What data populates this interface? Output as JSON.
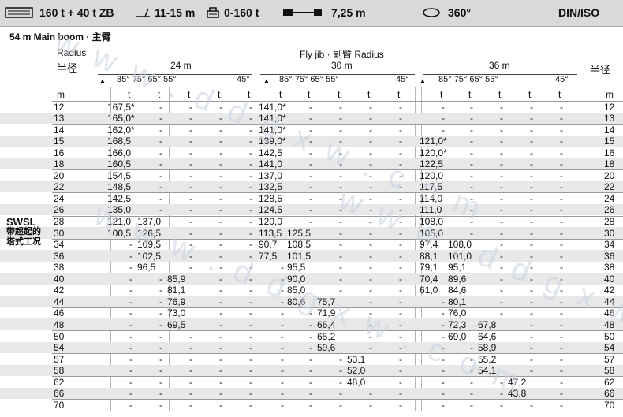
{
  "header": {
    "capacity": "160 t + 40 t ZB",
    "jib_angle": "11-15 m",
    "counterweight": "0-160 t",
    "track_width": "7,25 m",
    "slewing": "360°",
    "standard": "DIN/ISO"
  },
  "boom_label": "54 m  Main boom · 主臂",
  "radius_label": "Radius",
  "radius_label_cn": "半径",
  "fly_jib_label": "Fly jib · 副臂 Radius",
  "radius_right_cn": "半径",
  "jib_lengths": [
    "24 m",
    "30 m",
    "36 m"
  ],
  "angle_groups": [
    {
      "main": "85° 75° 65° 55°",
      "end": "45°"
    },
    {
      "main": "85° 75° 65° 55°",
      "end": "45°"
    },
    {
      "main": "85° 75° 65° 55°",
      "end": "45°"
    }
  ],
  "units": {
    "left": "m",
    "right": "m",
    "t": [
      "t",
      "t",
      "t",
      "t",
      "t",
      "t",
      "t",
      "t",
      "t",
      "t",
      "t",
      "t",
      "t",
      "t",
      "t"
    ]
  },
  "side_label": {
    "en": "SWSL",
    "cn1": "带超起的",
    "cn2": "塔式工况"
  },
  "rows": [
    {
      "r": "12",
      "v": [
        "167,5*",
        "-",
        "-",
        "-",
        "-",
        "141,0*",
        "-",
        "-",
        "-",
        "-",
        "-",
        "-",
        "-",
        "-",
        "-"
      ]
    },
    {
      "r": "13",
      "v": [
        "165,0*",
        "-",
        "-",
        "-",
        "-",
        "141,0*",
        "-",
        "-",
        "-",
        "-",
        "-",
        "-",
        "-",
        "-",
        "-"
      ]
    },
    {
      "r": "14",
      "v": [
        "162,0*",
        "-",
        "-",
        "-",
        "-",
        "141,0*",
        "-",
        "-",
        "-",
        "-",
        "-",
        "-",
        "-",
        "-",
        "-"
      ]
    },
    {
      "r": "15",
      "v": [
        "168,5",
        "-",
        "-",
        "-",
        "-",
        "139,0*",
        "-",
        "-",
        "-",
        "-",
        "121,0*",
        "-",
        "-",
        "-",
        "-"
      ]
    },
    {
      "r": "16",
      "v": [
        "166,0",
        "-",
        "-",
        "-",
        "-",
        "142,5",
        "-",
        "-",
        "-",
        "-",
        "120,0*",
        "-",
        "-",
        "-",
        "-"
      ]
    },
    {
      "r": "18",
      "v": [
        "160,5",
        "-",
        "-",
        "-",
        "-",
        "141,0",
        "-",
        "-",
        "-",
        "-",
        "122,5",
        "-",
        "-",
        "-",
        "-"
      ]
    },
    {
      "r": "20",
      "v": [
        "154,5",
        "-",
        "-",
        "-",
        "-",
        "137,0",
        "-",
        "-",
        "-",
        "-",
        "120,0",
        "-",
        "-",
        "-",
        "-"
      ]
    },
    {
      "r": "22",
      "v": [
        "148,5",
        "-",
        "-",
        "-",
        "-",
        "132,5",
        "-",
        "-",
        "-",
        "-",
        "117,5",
        "-",
        "-",
        "-",
        "-"
      ]
    },
    {
      "r": "24",
      "v": [
        "142,5",
        "-",
        "-",
        "-",
        "-",
        "128,5",
        "-",
        "-",
        "-",
        "-",
        "114,0",
        "-",
        "-",
        "-",
        "-"
      ]
    },
    {
      "r": "26",
      "v": [
        "135,0",
        "-",
        "-",
        "-",
        "-",
        "124,5",
        "-",
        "-",
        "-",
        "-",
        "111,0",
        "-",
        "-",
        "-",
        "-"
      ]
    },
    {
      "r": "28",
      "v": [
        "121,0",
        "137,0",
        "-",
        "-",
        "-",
        "120,0",
        "-",
        "-",
        "-",
        "-",
        "108,0",
        "-",
        "-",
        "-",
        "-"
      ]
    },
    {
      "r": "30",
      "v": [
        "100,5",
        "126,5",
        "-",
        "-",
        "-",
        "113,5",
        "125,5",
        "-",
        "-",
        "-",
        "105,0",
        "-",
        "-",
        "-",
        "-"
      ]
    },
    {
      "r": "34",
      "v": [
        "-",
        "109,5",
        "-",
        "-",
        "-",
        "90,7",
        "108,5",
        "-",
        "-",
        "-",
        "97,4",
        "108,0",
        "-",
        "-",
        "-"
      ]
    },
    {
      "r": "36",
      "v": [
        "-",
        "102,5",
        "-",
        "-",
        "-",
        "77,5",
        "101,5",
        "-",
        "-",
        "-",
        "88,1",
        "101,0",
        "-",
        "-",
        "-"
      ]
    },
    {
      "r": "38",
      "v": [
        "-",
        "96,5",
        "-",
        "-",
        "-",
        "-",
        "95,5",
        "-",
        "-",
        "-",
        "79,1",
        "95,1",
        "-",
        "-",
        "-"
      ]
    },
    {
      "r": "40",
      "v": [
        "-",
        "-",
        "85,9",
        "-",
        "-",
        "-",
        "90,0",
        "-",
        "-",
        "-",
        "70,4",
        "89,6",
        "-",
        "-",
        "-"
      ]
    },
    {
      "r": "42",
      "v": [
        "-",
        "-",
        "81,1",
        "-",
        "-",
        "-",
        "85,0",
        "-",
        "-",
        "-",
        "61,0",
        "84,6",
        "-",
        "-",
        "-"
      ]
    },
    {
      "r": "44",
      "v": [
        "-",
        "-",
        "76,9",
        "-",
        "-",
        "-",
        "80,6",
        "75,7",
        "-",
        "-",
        "-",
        "80,1",
        "-",
        "-",
        "-"
      ]
    },
    {
      "r": "46",
      "v": [
        "-",
        "-",
        "73,0",
        "-",
        "-",
        "-",
        "-",
        "71,9",
        "-",
        "-",
        "-",
        "76,0",
        "-",
        "-",
        "-"
      ]
    },
    {
      "r": "48",
      "v": [
        "-",
        "-",
        "69,5",
        "-",
        "-",
        "-",
        "-",
        "66,4",
        "-",
        "-",
        "-",
        "72,3",
        "67,8",
        "-",
        "-"
      ]
    },
    {
      "r": "50",
      "v": [
        "-",
        "-",
        "-",
        "-",
        "-",
        "-",
        "-",
        "65,2",
        "-",
        "-",
        "-",
        "69,0",
        "64,6",
        "-",
        "-"
      ]
    },
    {
      "r": "54",
      "v": [
        "-",
        "-",
        "-",
        "-",
        "-",
        "-",
        "-",
        "59,6",
        "-",
        "-",
        "-",
        "-",
        "58,9",
        "-",
        "-"
      ]
    },
    {
      "r": "57",
      "v": [
        "-",
        "-",
        "-",
        "-",
        "-",
        "-",
        "-",
        "-",
        "53,1",
        "-",
        "-",
        "-",
        "55,2",
        "-",
        "-"
      ]
    },
    {
      "r": "58",
      "v": [
        "-",
        "-",
        "-",
        "-",
        "-",
        "-",
        "-",
        "-",
        "52,0",
        "-",
        "-",
        "-",
        "54,1",
        "-",
        "-"
      ]
    },
    {
      "r": "62",
      "v": [
        "-",
        "-",
        "-",
        "-",
        "-",
        "-",
        "-",
        "-",
        "48,0",
        "-",
        "-",
        "-",
        "-",
        "47,2",
        "-"
      ]
    },
    {
      "r": "66",
      "v": [
        "-",
        "-",
        "-",
        "-",
        "-",
        "-",
        "-",
        "-",
        "-",
        "-",
        "-",
        "-",
        "-",
        "43,8",
        "-"
      ]
    },
    {
      "r": "70",
      "v": [
        "-",
        "-",
        "-",
        "-",
        "-",
        "-",
        "-",
        "-",
        "-",
        "-",
        "-",
        "-",
        "-",
        "-",
        "-"
      ]
    }
  ],
  "watermark": "w w w . d d g x w . c o m"
}
